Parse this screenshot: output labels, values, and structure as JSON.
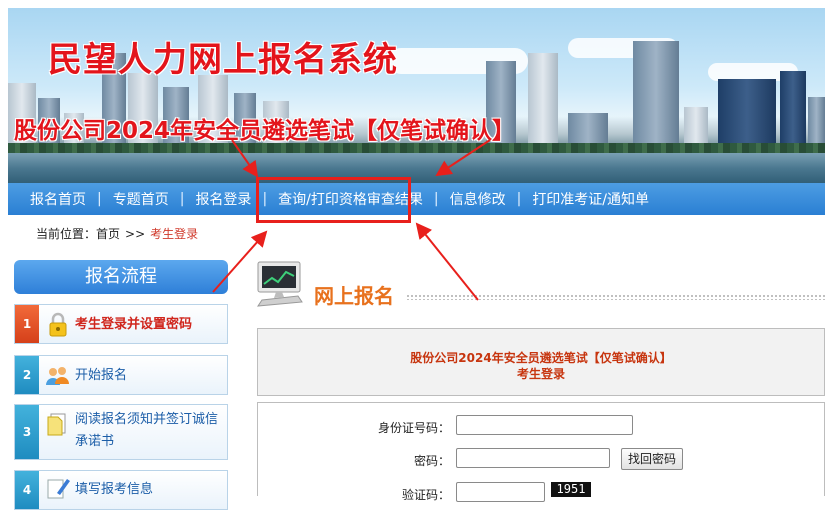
{
  "banner": {
    "title": "民望人力网上报名系统",
    "subtitle": "股份公司2024年安全员遴选笔试【仅笔试确认】"
  },
  "nav": {
    "items": [
      "报名首页",
      "专题首页",
      "报名登录",
      "查询/打印资格审查结果",
      "信息修改",
      "打印准考证/通知单"
    ],
    "separator": "|"
  },
  "breadcrumb": {
    "prefix": "当前位置：",
    "home": "首页",
    "arrow": ">>",
    "current": "考生登录"
  },
  "sidebar": {
    "title": "报名流程",
    "items": [
      {
        "num": "1",
        "label": "考生登录并设置密码",
        "icon": "lock-icon"
      },
      {
        "num": "2",
        "label": "开始报名",
        "icon": "users-icon"
      },
      {
        "num": "3",
        "label": "阅读报名须知并签订诚信承诺书",
        "icon": "document-icon"
      },
      {
        "num": "4",
        "label": "填写报考信息",
        "icon": "edit-icon"
      }
    ]
  },
  "main": {
    "section_title": "网上报名",
    "notice_line1": "股份公司2024年安全员遴选笔试【仅笔试确认】",
    "notice_line2": "考生登录",
    "form": {
      "id_label": "身份证号码：",
      "id_value": "",
      "password_label": "密码：",
      "password_value": "",
      "forgot_button": "找回密码",
      "captcha_label": "验证码：",
      "captcha_value": "",
      "captcha_image_text": "1951"
    }
  },
  "colors": {
    "nav_blue": "#2a7fd3",
    "annotation_red": "#e8201c",
    "title_red": "#e3141b",
    "section_orange": "#e8711d"
  }
}
